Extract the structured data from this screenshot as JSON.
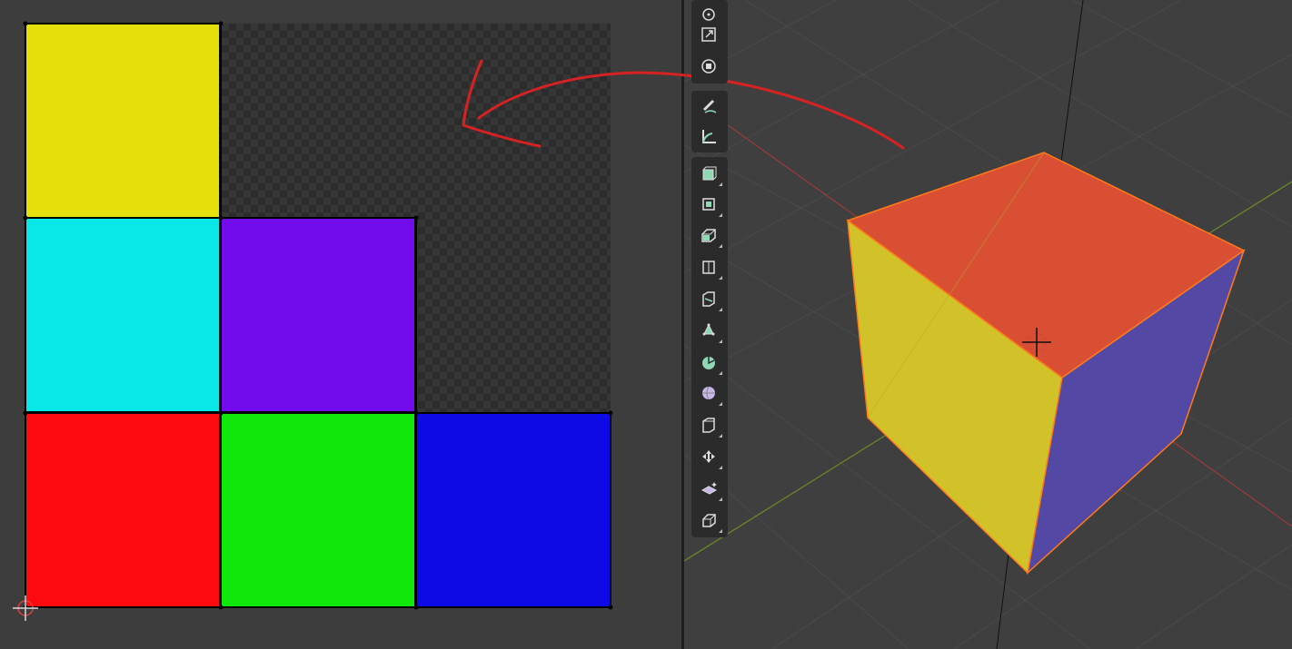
{
  "uv_editor": {
    "tiles": [
      {
        "color": "#e5e00c",
        "name": "uv-tile-yellow"
      },
      {
        "color": "#08e8e6",
        "name": "uv-tile-cyan"
      },
      {
        "color": "#720cec",
        "name": "uv-tile-purple"
      },
      {
        "color": "#fe0b0f",
        "name": "uv-tile-red"
      },
      {
        "color": "#10e80c",
        "name": "uv-tile-green"
      },
      {
        "color": "#0e0ae6",
        "name": "uv-tile-blue"
      }
    ],
    "annotation_color": "#d62222"
  },
  "viewport": {
    "cube": {
      "top_color": "#d84f33",
      "left_color": "#d2c22a",
      "right_color": "#5448a5",
      "outline_color": "#ff7a1a"
    },
    "axis_x_color": "#9a3b3b",
    "axis_y_color": "#6b8a2a",
    "toolbar": [
      {
        "name": "rotate-icon"
      },
      {
        "name": "scale-icon"
      },
      {
        "name": "transform-icon"
      },
      {
        "name": "annotate-icon"
      },
      {
        "name": "measure-icon"
      },
      {
        "name": "add-cube-icon"
      },
      {
        "name": "extrude-region-icon"
      },
      {
        "name": "inset-faces-icon"
      },
      {
        "name": "bevel-icon"
      },
      {
        "name": "loop-cut-icon"
      },
      {
        "name": "knife-icon"
      },
      {
        "name": "poly-build-icon"
      },
      {
        "name": "spin-icon"
      },
      {
        "name": "smooth-icon"
      },
      {
        "name": "edge-slide-icon"
      },
      {
        "name": "shrink-fatten-icon"
      },
      {
        "name": "shear-icon"
      },
      {
        "name": "rip-region-icon"
      }
    ]
  }
}
